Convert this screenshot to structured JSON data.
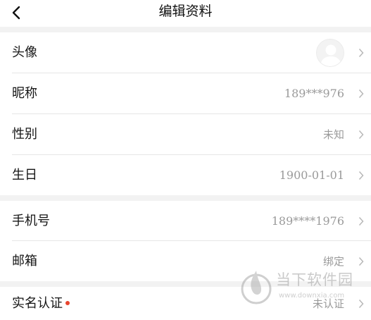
{
  "header": {
    "title": "编辑资料",
    "back_icon": "back-chevron-icon"
  },
  "profile": {
    "avatar": {
      "label": "头像",
      "icon": "default-avatar-icon"
    },
    "nickname": {
      "label": "昵称",
      "value": "189***976"
    },
    "gender": {
      "label": "性别",
      "value": "未知"
    },
    "birthday": {
      "label": "生日",
      "value": "1900-01-01"
    }
  },
  "account": {
    "phone": {
      "label": "手机号",
      "value": "189****1976"
    },
    "email": {
      "label": "邮箱",
      "value": "绑定"
    }
  },
  "verification": {
    "real_name": {
      "label": "实名认证",
      "value": "未认证",
      "has_red_dot": true
    }
  },
  "watermark": {
    "brand_text": "当下软件园",
    "url": "www.downxia.com"
  },
  "colors": {
    "background": "#ffffff",
    "section_gap": "#f2f2f2",
    "divider": "#e6e6e6",
    "label_text": "#151515",
    "value_text": "#9a9a9a",
    "red_dot": "#e8452e"
  }
}
